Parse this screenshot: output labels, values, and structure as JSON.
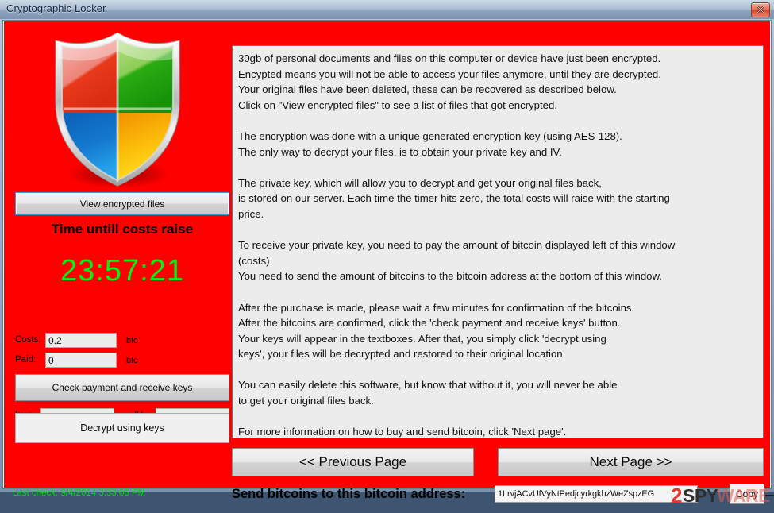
{
  "window": {
    "title": "Cryptographic Locker",
    "close_icon": "close-icon"
  },
  "left_panel": {
    "logo_icon": "security-shield-icon",
    "view_encrypted_files_label": "View encrypted files",
    "timer_label": "Time untill costs raise",
    "timer_value": "23:57:21",
    "timer_color": "#00f411",
    "costs_label": "Costs:",
    "costs_value": "0.2",
    "costs_unit": "btc",
    "paid_label": "Paid:",
    "paid_value": "0",
    "paid_unit": "btc",
    "check_payment_label": "Check payment and receive keys",
    "key_label": "key:",
    "key_value": "",
    "iv_label": "IV:",
    "iv_value": "",
    "decrypt_label": "Decrypt using keys",
    "last_check": "Last check: 9/4/2014 3:33:06 PM",
    "last_check_color": "#00d80f",
    "background_color": "#fe0000"
  },
  "message": {
    "para1_line1": "30gb of personal documents and files on this computer or device have just been encrypted.",
    "para1_line2": "Encypted means you will not be able to access your files anymore, until they are decrypted.",
    "para1_line3": "Your original files have been deleted, these can be recovered as described below.",
    "para1_line4": "Click on \"View encrypted files\" to see a list of files that got encrypted.",
    "para2_line1": "The encryption was done with a unique generated encryption key (using AES-128).",
    "para2_line2": "The only way to decrypt your files, is to obtain your private key and IV.",
    "para3_line1": "The private key, which will allow you to decrypt and get your original files back,",
    "para3_line2": "is stored on our server. Each time the timer hits zero, the total costs will raise with the starting",
    "para3_line3": "price.",
    "para4_line1": "To receive your private key, you need to pay the amount of bitcoin displayed left of this window",
    "para4_line2": "(costs).",
    "para4_line3": "You need to send the amount of bitcoins to the bitcoin address at the bottom of this window.",
    "para5_line1": "After the purchase is made, please wait a few minutes for confirmation of the bitcoins.",
    "para5_line2": "After the bitcoins are confirmed, click the 'check payment and receive keys' button.",
    "para5_line3": "Your keys will appear in the textboxes. After that, you simply click 'decrypt using",
    "para5_line4": "keys', your files will be decrypted and restored to their original location.",
    "para6_line1": "You can easily delete this software, but know that without it, you will never be able",
    "para6_line2": "to get your original files back.",
    "para7_line1": "For more information on how to buy and send bitcoin, click 'Next page'."
  },
  "navigation": {
    "previous_label": "<< Previous Page",
    "next_label": "Next Page >>"
  },
  "footer": {
    "send_label": "Send bitcoins to this bitcoin address:",
    "bitcoin_address": "1LrvjACvUfVyNtPedjcyrkgkhzWeZspzEG",
    "copy_label": "Copy"
  },
  "watermark": {
    "part1": "2",
    "part2": "SPY",
    "part3": "WARE"
  }
}
